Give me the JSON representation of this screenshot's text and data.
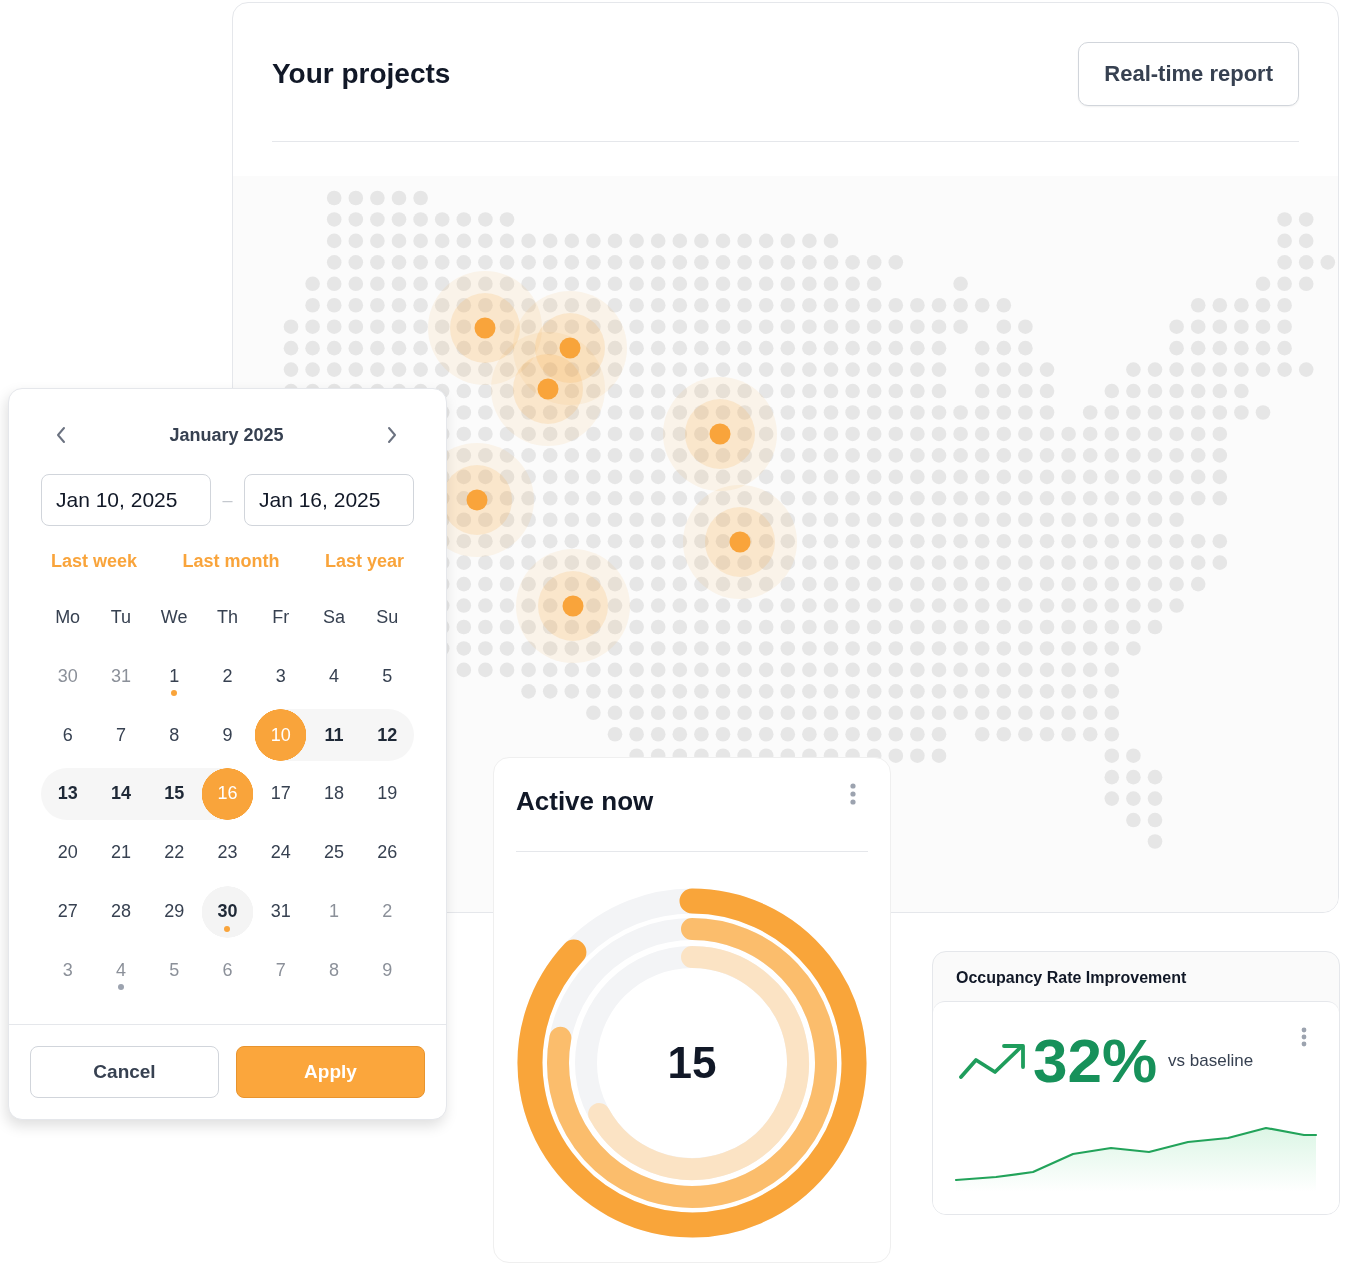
{
  "projects": {
    "title": "Your projects",
    "report_button": "Real-time report"
  },
  "calendar": {
    "month": "January 2025",
    "start_date": "Jan 10, 2025",
    "separator": "–",
    "end_date": "Jan 16, 2025",
    "presets": [
      "Last week",
      "Last month",
      "Last year"
    ],
    "weekdays": [
      "Mo",
      "Tu",
      "We",
      "Th",
      "Fr",
      "Sa",
      "Su"
    ],
    "days": [
      {
        "label": "30",
        "outside": true,
        "selected": false,
        "in_range": false,
        "today": false
      },
      {
        "label": "31",
        "outside": true,
        "selected": false,
        "in_range": false,
        "today": false
      },
      {
        "label": "1",
        "outside": false,
        "selected": false,
        "in_range": false,
        "today": false,
        "color": "#f9a43b"
      },
      {
        "label": "2",
        "outside": false,
        "selected": false,
        "in_range": false,
        "today": false
      },
      {
        "label": "3",
        "outside": false,
        "selected": false,
        "in_range": false,
        "today": false
      },
      {
        "label": "4",
        "outside": false,
        "selected": false,
        "in_range": false,
        "today": false
      },
      {
        "label": "5",
        "outside": false,
        "selected": false,
        "in_range": false,
        "today": false
      },
      {
        "label": "6",
        "outside": false,
        "selected": false,
        "in_range": false,
        "today": false
      },
      {
        "label": "7",
        "outside": false,
        "selected": false,
        "in_range": false,
        "today": false
      },
      {
        "label": "8",
        "outside": false,
        "selected": false,
        "in_range": false,
        "today": false
      },
      {
        "label": "9",
        "outside": false,
        "selected": false,
        "in_range": false,
        "today": false
      },
      {
        "label": "10",
        "outside": false,
        "selected": true,
        "in_range": false,
        "today": false
      },
      {
        "label": "11",
        "outside": false,
        "selected": false,
        "in_range": true,
        "today": false
      },
      {
        "label": "12",
        "outside": false,
        "selected": false,
        "in_range": true,
        "today": false
      },
      {
        "label": "13",
        "outside": false,
        "selected": false,
        "in_range": true,
        "today": false
      },
      {
        "label": "14",
        "outside": false,
        "selected": false,
        "in_range": true,
        "today": false
      },
      {
        "label": "15",
        "outside": false,
        "selected": false,
        "in_range": true,
        "today": false
      },
      {
        "label": "16",
        "outside": false,
        "selected": true,
        "in_range": false,
        "today": false
      },
      {
        "label": "17",
        "outside": false,
        "selected": false,
        "in_range": false,
        "today": false
      },
      {
        "label": "18",
        "outside": false,
        "selected": false,
        "in_range": false,
        "today": false
      },
      {
        "label": "19",
        "outside": false,
        "selected": false,
        "in_range": false,
        "today": false
      },
      {
        "label": "20",
        "outside": false,
        "selected": false,
        "in_range": false,
        "today": false
      },
      {
        "label": "21",
        "outside": false,
        "selected": false,
        "in_range": false,
        "today": false
      },
      {
        "label": "22",
        "outside": false,
        "selected": false,
        "in_range": false,
        "today": false
      },
      {
        "label": "23",
        "outside": false,
        "selected": false,
        "in_range": false,
        "today": false
      },
      {
        "label": "24",
        "outside": false,
        "selected": false,
        "in_range": false,
        "today": false
      },
      {
        "label": "25",
        "outside": false,
        "selected": false,
        "in_range": false,
        "today": false
      },
      {
        "label": "26",
        "outside": false,
        "selected": false,
        "in_range": false,
        "today": false
      },
      {
        "label": "27",
        "outside": false,
        "selected": false,
        "in_range": false,
        "today": false
      },
      {
        "label": "28",
        "outside": false,
        "selected": false,
        "in_range": false,
        "today": false
      },
      {
        "label": "29",
        "outside": false,
        "selected": false,
        "in_range": false,
        "today": false
      },
      {
        "label": "30",
        "outside": false,
        "selected": false,
        "in_range": false,
        "today": true,
        "color": "#f9a43b"
      },
      {
        "label": "31",
        "outside": false,
        "selected": false,
        "in_range": false,
        "today": false
      },
      {
        "label": "1",
        "outside": true,
        "selected": false,
        "in_range": false,
        "today": false
      },
      {
        "label": "2",
        "outside": true,
        "selected": false,
        "in_range": false,
        "today": false
      },
      {
        "label": "3",
        "outside": true,
        "selected": false,
        "in_range": false,
        "today": false
      },
      {
        "label": "4",
        "outside": true,
        "selected": false,
        "in_range": false,
        "today": false,
        "color": "#9ca3af"
      },
      {
        "label": "5",
        "outside": true,
        "selected": false,
        "in_range": false,
        "today": false
      },
      {
        "label": "6",
        "outside": true,
        "selected": false,
        "in_range": false,
        "today": false
      },
      {
        "label": "7",
        "outside": true,
        "selected": false,
        "in_range": false,
        "today": false
      },
      {
        "label": "8",
        "outside": true,
        "selected": false,
        "in_range": false,
        "today": false
      },
      {
        "label": "9",
        "outside": true,
        "selected": false,
        "in_range": false,
        "today": false
      }
    ],
    "cancel": "Cancel",
    "apply": "Apply"
  },
  "active_now": {
    "title": "Active now",
    "value": "15"
  },
  "occupancy": {
    "title": "Occupancy Rate Improvement",
    "value": "32%",
    "caption": "vs baseline"
  }
}
